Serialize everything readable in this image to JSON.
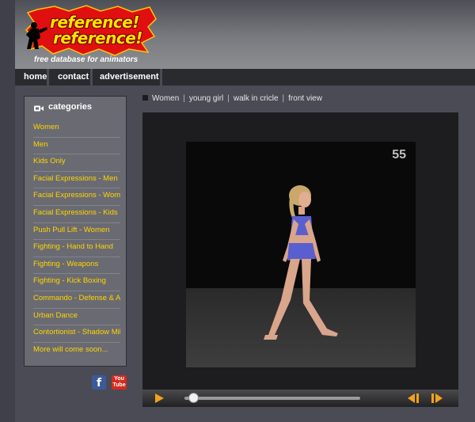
{
  "logo": {
    "line1": "reference!",
    "line2": "reference!",
    "tagline": "free database for animators"
  },
  "nav": {
    "items": [
      "home",
      "contact",
      "advertisement"
    ]
  },
  "sidebar": {
    "title": "categories",
    "items": [
      "Women",
      "Men",
      "Kids Only",
      "Facial Expressions - Men",
      "Facial Expressions - Women",
      "Facial Expressions - Kids",
      "Push Pull Lift - Women",
      "Fighting - Hand to Hand",
      "Fighting - Weapons",
      "Fighting - Kick Boxing",
      "Commando - Defense & Aid",
      "Urban Dance",
      "Contortionist - Shadow Mike",
      "More will come soon..."
    ]
  },
  "social": {
    "facebook": "f",
    "youtube_top": "You",
    "youtube_bottom": "Tube"
  },
  "breadcrumb": [
    "Women",
    "young girl",
    "walk in cricle",
    "front view"
  ],
  "player": {
    "frame_counter": "55",
    "progress": 0.05
  },
  "colors": {
    "accent": "#ffd400",
    "play": "#f3a21a"
  }
}
